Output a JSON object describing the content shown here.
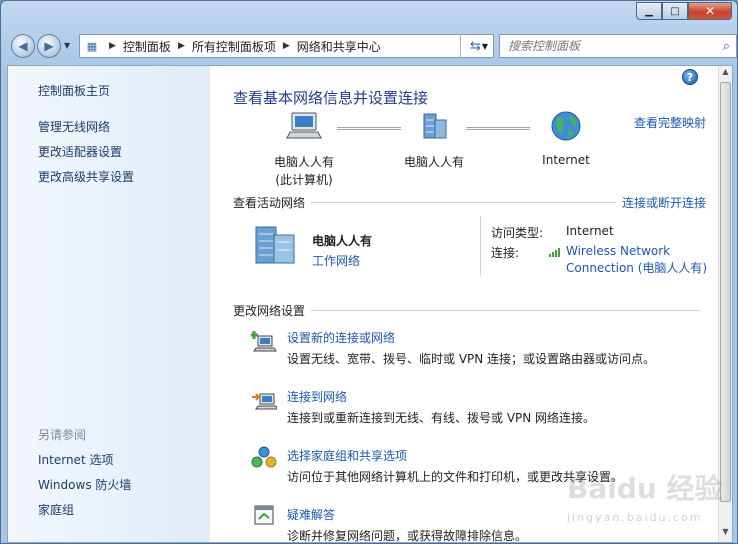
{
  "nav": {
    "breadcrumb": [
      "控制面板",
      "所有控制面板项",
      "网络和共享中心"
    ],
    "search_placeholder": "搜索控制面板"
  },
  "sidebar": {
    "home": "控制面板主页",
    "links": [
      "管理无线网络",
      "更改适配器设置",
      "更改高级共享设置"
    ],
    "see_also_header": "另请参阅",
    "see_also": [
      "Internet 选项",
      "Windows 防火墙",
      "家庭组"
    ]
  },
  "main": {
    "title": "查看基本网络信息并设置连接",
    "full_map_link": "查看完整映射",
    "nodes": [
      {
        "line1": "电脑人人有",
        "line2": "(此计算机)"
      },
      {
        "line1": "电脑人人有",
        "line2": ""
      },
      {
        "line1": "Internet",
        "line2": ""
      }
    ],
    "active_networks": {
      "header": "查看活动网络",
      "connect_link": "连接或断开连接",
      "network_name": "电脑人人有",
      "network_type": "工作网络",
      "access_type_label": "访问类型:",
      "access_type_value": "Internet",
      "connection_label": "连接:",
      "connection_value_line1": "Wireless Network",
      "connection_value_line2": "Connection (电脑人人有)"
    },
    "change_settings": {
      "header": "更改网络设置",
      "tasks": [
        {
          "link": "设置新的连接或网络",
          "desc": "设置无线、宽带、拨号、临时或 VPN 连接；或设置路由器或访问点。"
        },
        {
          "link": "连接到网络",
          "desc": "连接到或重新连接到无线、有线、拨号或 VPN 网络连接。"
        },
        {
          "link": "选择家庭组和共享选项",
          "desc": "访问位于其他网络计算机上的文件和打印机，或更改共享设置。"
        },
        {
          "link": "疑难解答",
          "desc": "诊断并修复网络问题，或获得故障排除信息。"
        }
      ]
    }
  },
  "watermark": {
    "text": "Baidu 经验",
    "sub": "jingyan.baidu.com"
  },
  "colors": {
    "link": "#1d57b5",
    "title": "#1e3f8f",
    "sidebar_link": "#1f3b6c"
  }
}
